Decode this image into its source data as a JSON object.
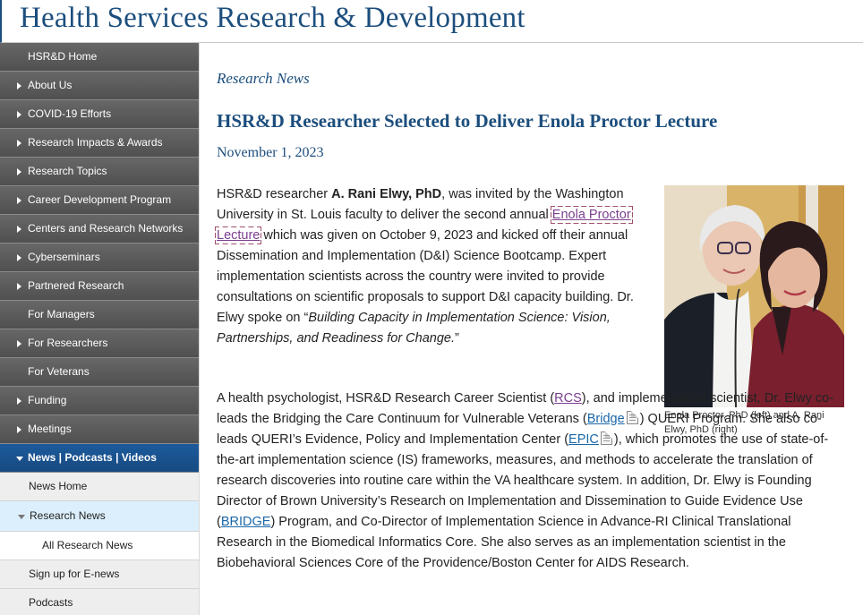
{
  "header": {
    "title": "Health Services Research & Development"
  },
  "sidebar": {
    "items": [
      {
        "label": "HSR&D Home"
      },
      {
        "label": "About Us"
      },
      {
        "label": "COVID-19 Efforts"
      },
      {
        "label": "Research Impacts & Awards"
      },
      {
        "label": "Research Topics"
      },
      {
        "label": "Career Development Program"
      },
      {
        "label": "Centers and Research Networks"
      },
      {
        "label": "Cyberseminars"
      },
      {
        "label": "Partnered Research"
      },
      {
        "label": "For Managers"
      },
      {
        "label": "For Researchers"
      },
      {
        "label": "For Veterans"
      },
      {
        "label": "Funding"
      },
      {
        "label": "Meetings"
      },
      {
        "label": "News | Podcasts | Videos"
      }
    ],
    "subitems": [
      {
        "label": "News Home"
      },
      {
        "label": "Research News"
      },
      {
        "label": "All Research News"
      },
      {
        "label": "Sign up for E-news"
      },
      {
        "label": "Podcasts"
      }
    ]
  },
  "article": {
    "section": "Research News",
    "title": "HSR&D Researcher Selected to Deliver Enola Proctor Lecture",
    "date": "November 1, 2023",
    "p1": {
      "t1": "HSR&D researcher ",
      "name": "A. Rani Elwy, PhD",
      "t2": ", was invited by the Washington University in St. Louis faculty to deliver the second annual ",
      "link": "Enola Proctor Lecture",
      "t3": " which was given on October 9, 2023 and kicked off their annual Dissemination and Implementation (D&I) Science Bootcamp. Expert implementation scientists across the country were invited to provide consultations on scientific proposals to support D&I capacity building. Dr. Elwy spoke on “",
      "quote": "Building Capacity in Implementation Science: Vision, Partnerships, and Readiness for Change.",
      "t4": "”"
    },
    "p2": {
      "t1": "A health psychologist, HSR&D Research Career Scientist (",
      "rcs": "RCS",
      "t2": "), and implementation scientist, Dr. Elwy co-leads the Bridging the Care Continuum for Vulnerable Veterans (",
      "bridge": "Bridge",
      "t3": ") QUERI Program. She also co-leads QUERI’s Evidence, Policy and Implementation Center (",
      "epic": "EPIC",
      "t4": "), which promotes the use of state-of-the-art implementation science (IS) frameworks, measures, and methods to accelerate the translation of research discoveries into routine care within the VA healthcare system. In addition, Dr. Elwy is Founding Director of Brown University’s Research on Implementation and Dissemination to Guide Evidence Use (",
      "bridge2": "BRIDGE",
      "t5": ") Program, and Co-Director of Implementation Science in Advance-RI Clinical Translational Research in the Biomedical Informatics Core. She also serves as an implementation scientist in the  Biobehavioral Sciences Core of the Providence/Boston Center for AIDS Research."
    },
    "caption": "Enola Proctor, PhD (left) and A. Rani Elwy, PhD (right)"
  },
  "icons": {
    "pdf": "pdf-icon",
    "nav_arrow": "chevron-right-icon",
    "nav_open": "chevron-down-icon"
  },
  "colors": {
    "brand": "#1c4e7d",
    "nav_bg": "#5a5a5a",
    "nav_active": "#1c5a9c",
    "sub_current": "#dceffd",
    "visited_link": "#7b3f8f",
    "link": "#1a67a8"
  }
}
